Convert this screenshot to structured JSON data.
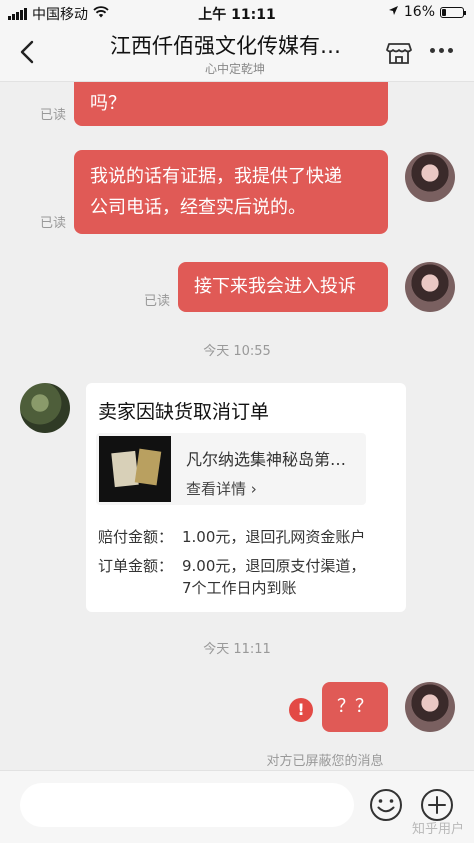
{
  "status_bar": {
    "carrier": "中国移动",
    "time": "上午 11:11",
    "battery": "16%",
    "battery_level": 0.16
  },
  "header": {
    "title": "江西仟佰强文化传媒有…",
    "subtitle": "心中定乾坤",
    "icons": [
      "back-arrow-icon",
      "shop-icon",
      "more-icon"
    ]
  },
  "messages": [
    {
      "text": "吗？",
      "read": "已读"
    },
    {
      "line1": "我说的话有证据，我提供了快递",
      "line2": "公司电话，经查实后说的。",
      "read": "已读"
    },
    {
      "text": "接下来我会进入投诉",
      "read": "已读"
    },
    {
      "text": "？？"
    }
  ],
  "timestamps": [
    "今天 10:55",
    "今天 11:11"
  ],
  "order_card": {
    "title": "卖家因缺货取消订单",
    "product_name": "凡尔纳选集神秘岛第…",
    "detail_link": "查看详情 ›",
    "compensation_label": "赔付金额：",
    "compensation_value": "1.00元，退回孔网资金账户",
    "order_label": "订单金额：",
    "order_value_line1": "9.00元，退回原支付渠道，",
    "order_value_line2": "7个工作日内到账"
  },
  "warning_icon": "!",
  "blocked_notice": "对方已屏蔽您的消息",
  "input_bar": {
    "placeholder": "",
    "icons": [
      "emoji-icon",
      "plus-icon"
    ]
  },
  "watermark": "知乎用户",
  "colors": {
    "bubble": "#e05a56",
    "background": "#efefef",
    "warning": "#e34a45"
  }
}
